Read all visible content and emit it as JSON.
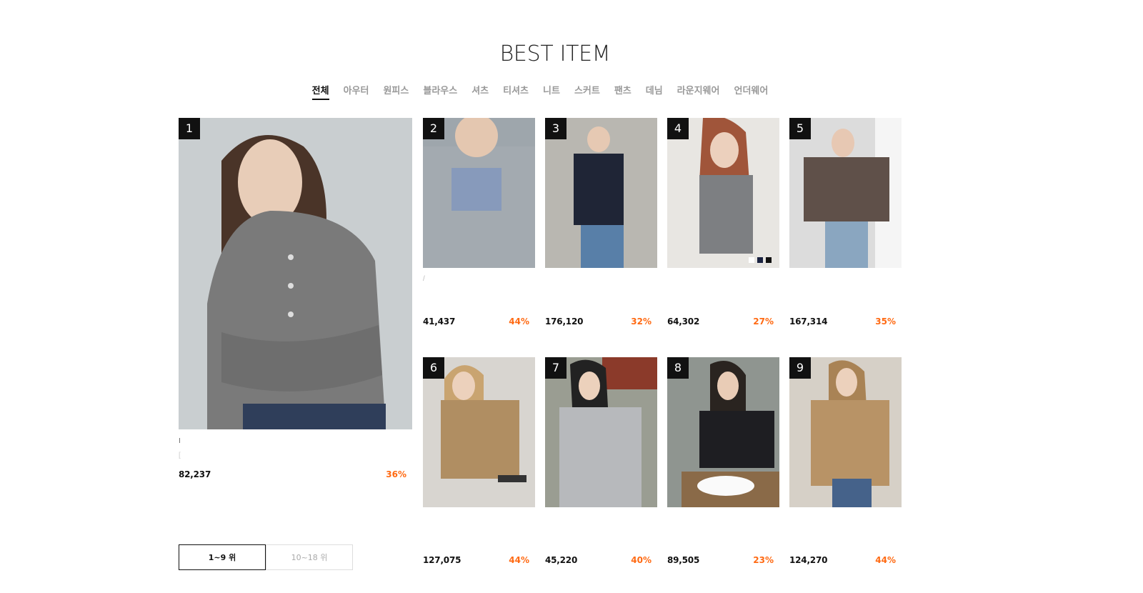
{
  "page": {
    "title": "BEST ITEM"
  },
  "tabs": [
    {
      "label": "전체",
      "active": true
    },
    {
      "label": "아우터",
      "active": false
    },
    {
      "label": "원피스",
      "active": false
    },
    {
      "label": "블라우스",
      "active": false
    },
    {
      "label": "셔츠",
      "active": false
    },
    {
      "label": "티셔츠",
      "active": false
    },
    {
      "label": "니트",
      "active": false
    },
    {
      "label": "스커트",
      "active": false
    },
    {
      "label": "팬츠",
      "active": false
    },
    {
      "label": "데님",
      "active": false
    },
    {
      "label": "라운지웨어",
      "active": false
    },
    {
      "label": "언더웨어",
      "active": false
    }
  ],
  "products": [
    {
      "rank": "1",
      "price": "82,237",
      "discount": "36%",
      "tick1": "I",
      "tick2": "["
    },
    {
      "rank": "2",
      "price": "41,437",
      "discount": "44%",
      "tick1": "/"
    },
    {
      "rank": "3",
      "price": "176,120",
      "discount": "32%"
    },
    {
      "rank": "4",
      "price": "64,302",
      "discount": "27%"
    },
    {
      "rank": "5",
      "price": "167,314",
      "discount": "35%"
    },
    {
      "rank": "6",
      "price": "127,075",
      "discount": "44%"
    },
    {
      "rank": "7",
      "price": "45,220",
      "discount": "40%"
    },
    {
      "rank": "8",
      "price": "89,505",
      "discount": "23%"
    },
    {
      "rank": "9",
      "price": "124,270",
      "discount": "44%"
    }
  ],
  "pager": {
    "page1": "1~9 위",
    "page2": "10~18 위",
    "active": 1
  },
  "colors": {
    "discount": "#ff6a13",
    "rank_bg": "#111111"
  }
}
